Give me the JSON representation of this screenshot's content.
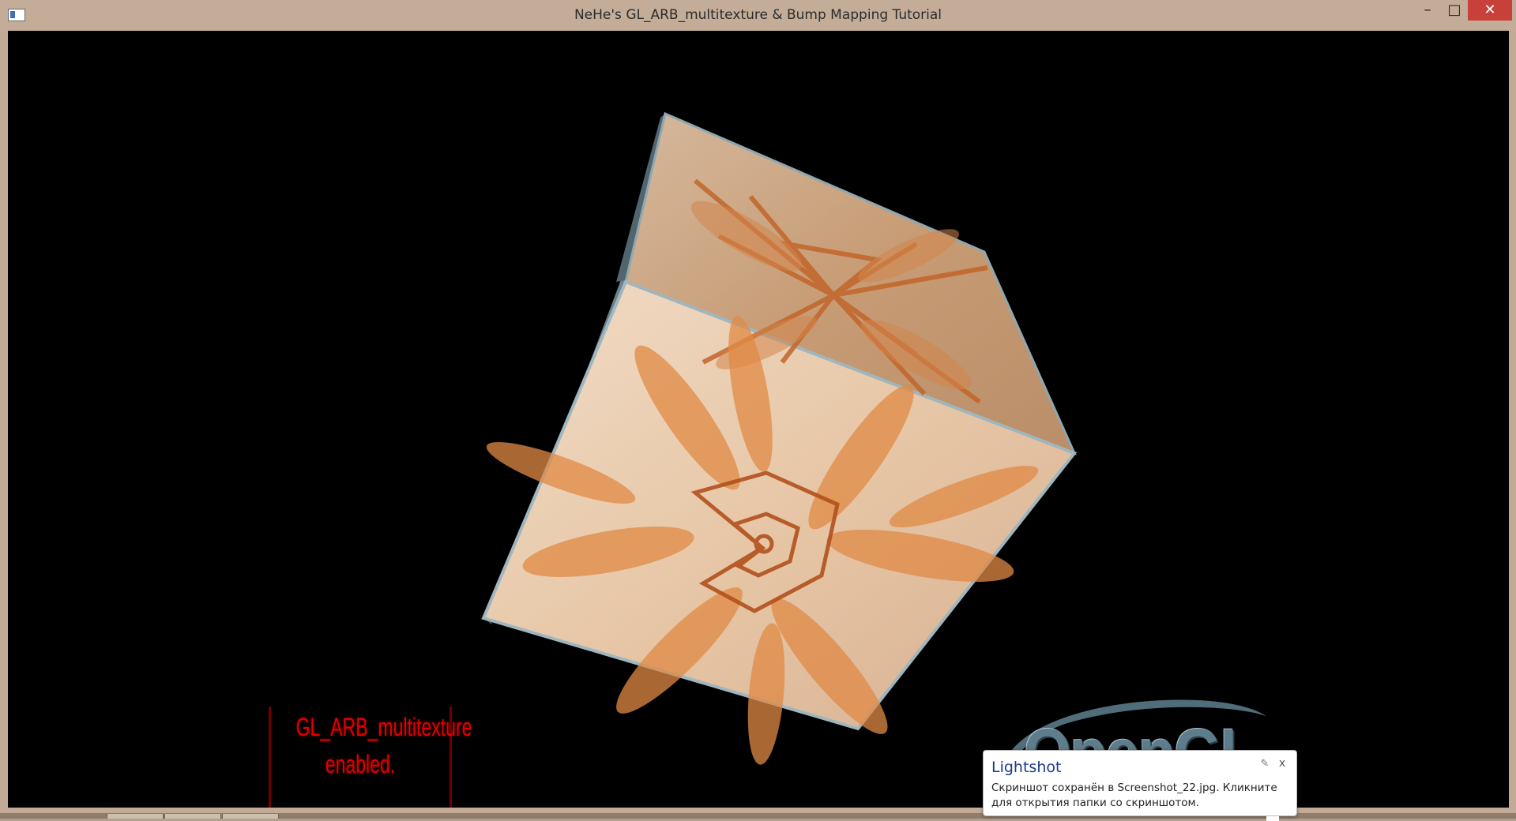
{
  "window": {
    "title": "NeHe's GL_ARB_multitexture & Bump Mapping Tutorial",
    "minimize_glyph": "–",
    "maximize_glyph": "□",
    "close_glyph": "✕"
  },
  "scene": {
    "status_line1": "GL_ARB_multitexture",
    "status_line2": "enabled.",
    "logo_text": "OpenGL",
    "logo_trademark": "™",
    "status_color": "#e00000"
  },
  "toast": {
    "title": "Lightshot",
    "message": "Скриншот сохранён в Screenshot_22.jpg. Кликните для открытия папки со скриншотом.",
    "close_glyph": "x",
    "pin_glyph": "✎"
  },
  "icons": {
    "app": "opengl-window-icon",
    "pin": "pin-icon",
    "close": "close-icon"
  }
}
